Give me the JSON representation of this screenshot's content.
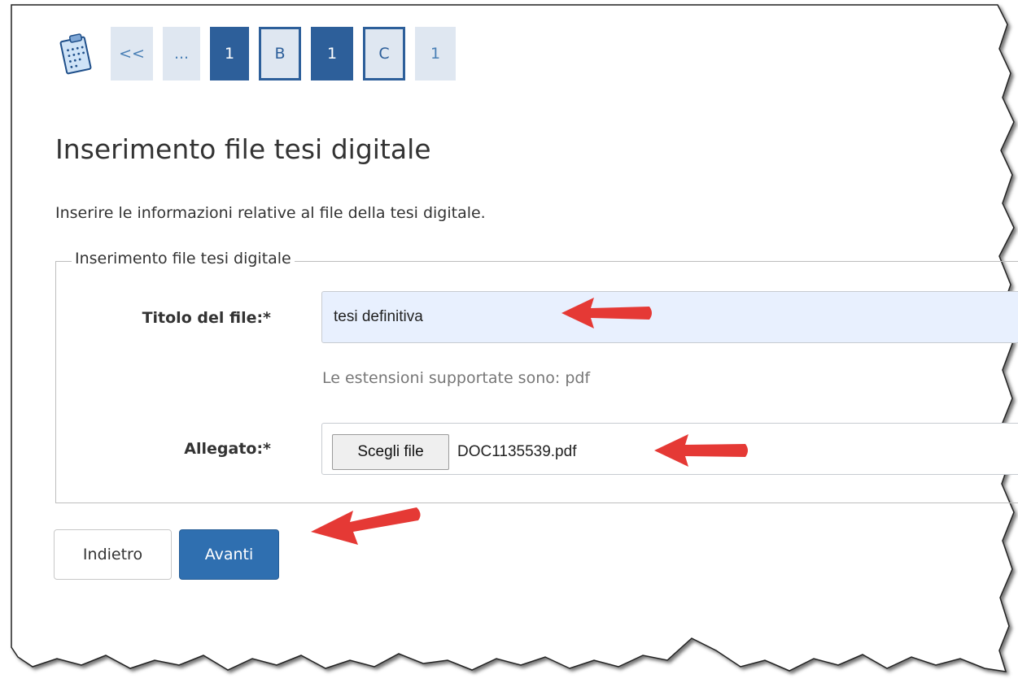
{
  "stepper": {
    "items": [
      {
        "label": "<<",
        "style": "light"
      },
      {
        "label": "...",
        "style": "light"
      },
      {
        "label": "1",
        "style": "dark"
      },
      {
        "label": "B",
        "style": "outline"
      },
      {
        "label": "1",
        "style": "dark"
      },
      {
        "label": "C",
        "style": "outline"
      },
      {
        "label": "1",
        "style": "light"
      }
    ]
  },
  "page": {
    "title": "Inserimento file tesi digitale",
    "intro": "Inserire le informazioni relative al file della tesi digitale."
  },
  "form": {
    "legend": "Inserimento file tesi digitale",
    "title_label": "Titolo del file:*",
    "title_value": "tesi definitiva",
    "hint": "Le estensioni supportate sono: pdf",
    "attachment_label": "Allegato:*",
    "choose_file_label": "Scegli file",
    "file_name": "DOC1135539.pdf"
  },
  "actions": {
    "back_label": "Indietro",
    "next_label": "Avanti"
  },
  "colors": {
    "accent": "#2f6fb0",
    "step_dark": "#2d5f9a",
    "step_light": "#dfe7f1",
    "input_fill": "#e8f0fe",
    "arrow": "#e53935"
  }
}
